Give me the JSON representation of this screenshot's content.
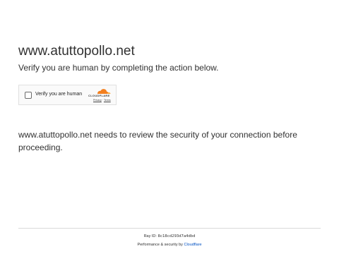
{
  "page": {
    "domain": "www.atuttopollo.net",
    "subtitle": "Verify you are human by completing the action below.",
    "body": "www.atuttopollo.net needs to review the security of your connection before proceeding."
  },
  "widget": {
    "checkbox_label": "Verify you are human",
    "brand": "CLOUDFLARE",
    "privacy_link": "Privacy",
    "separator": "·",
    "terms_link": "Terms"
  },
  "footer": {
    "ray_label": "Ray ID:",
    "ray_id": "8c18cd293d7a4dbd",
    "perf_prefix": "Performance & security by",
    "perf_link": "Cloudflare"
  },
  "colors": {
    "text": "#313131",
    "link": "#0051c3",
    "cloud_orange": "#f38020",
    "cloud_light": "#faae40"
  },
  "icons": [
    "cloudflare-cloud-icon"
  ]
}
